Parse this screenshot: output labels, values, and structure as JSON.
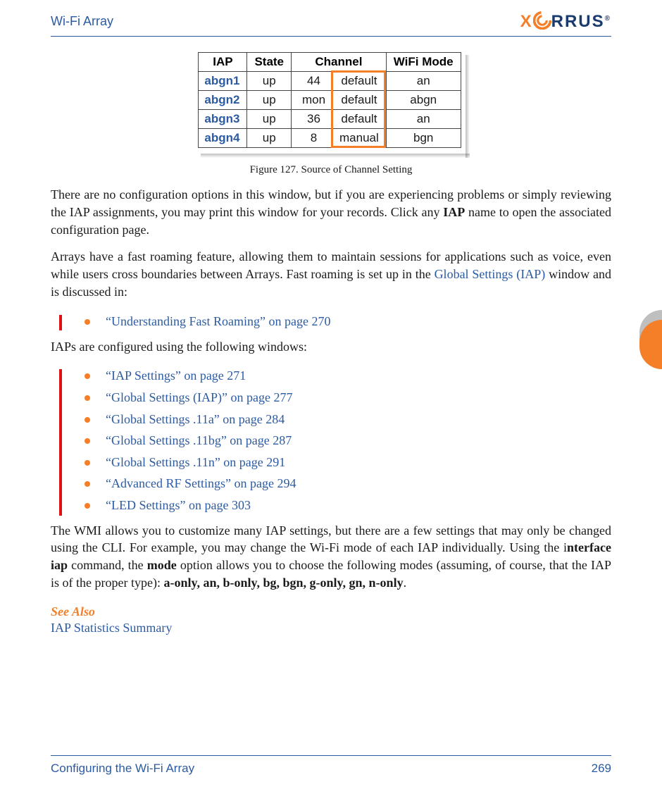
{
  "header": {
    "title": "Wi-Fi Array",
    "logo_text_1": "X",
    "logo_text_2": "I",
    "logo_text_3": "RRUS"
  },
  "table": {
    "headers": [
      "IAP",
      "State",
      "Channel",
      "WiFi Mode"
    ],
    "rows": [
      {
        "iap": "abgn1",
        "state": "up",
        "ch_num": "44",
        "ch_src": "default",
        "mode": "an"
      },
      {
        "iap": "abgn2",
        "state": "up",
        "ch_num": "mon",
        "ch_src": "default",
        "mode": "abgn"
      },
      {
        "iap": "abgn3",
        "state": "up",
        "ch_num": "36",
        "ch_src": "default",
        "mode": "an"
      },
      {
        "iap": "abgn4",
        "state": "up",
        "ch_num": "8",
        "ch_src": "manual",
        "mode": "bgn"
      }
    ]
  },
  "figure_caption": "Figure 127. Source of Channel Setting",
  "para1_a": "There are no configuration options in this window, but if you are experiencing problems or simply reviewing the IAP assignments, you may print this window for your records. Click any ",
  "para1_b": "IAP",
  "para1_c": " name to open the associated configuration page.",
  "para2_a": "Arrays have a fast roaming feature, allowing them to maintain sessions for applications such as voice, even while users cross boundaries between Arrays. Fast roaming is set up in the ",
  "para2_link": "Global Settings (IAP)",
  "para2_b": " window and is discussed in:",
  "list1": [
    "“Understanding Fast Roaming” on page 270"
  ],
  "para3": "IAPs are configured using the following windows:",
  "list2": [
    "“IAP Settings” on page 271",
    "“Global Settings (IAP)” on page 277",
    "“Global Settings .11a” on page 284",
    "“Global Settings .11bg” on page 287",
    "“Global Settings .11n” on page 291",
    "“Advanced RF Settings” on page 294",
    "“LED Settings” on page 303"
  ],
  "para4_a": "The WMI allows you to customize many IAP settings, but there are a few settings that may only be changed using the CLI. For example, you may change the Wi-Fi mode of each IAP individually. Using the i",
  "para4_cmd": "nterface iap",
  "para4_b": " command, the ",
  "para4_mode": "mode",
  "para4_c": " option allows you to choose the following modes (assuming, of course, that the IAP is of the proper type): ",
  "para4_modes": "a-only, an, b-only, bg, bgn, g-only, gn, n-only",
  "para4_d": ".",
  "see_also_heading": "See Also",
  "see_also_link": "IAP Statistics Summary",
  "footer": {
    "left": "Configuring the Wi-Fi Array",
    "right": "269"
  },
  "chart_data": {
    "type": "table",
    "title": "Source of Channel Setting",
    "columns": [
      "IAP",
      "State",
      "Channel (number)",
      "Channel (source)",
      "WiFi Mode"
    ],
    "rows": [
      [
        "abgn1",
        "up",
        "44",
        "default",
        "an"
      ],
      [
        "abgn2",
        "up",
        "mon",
        "default",
        "abgn"
      ],
      [
        "abgn3",
        "up",
        "36",
        "default",
        "an"
      ],
      [
        "abgn4",
        "up",
        "8",
        "manual",
        "bgn"
      ]
    ]
  }
}
